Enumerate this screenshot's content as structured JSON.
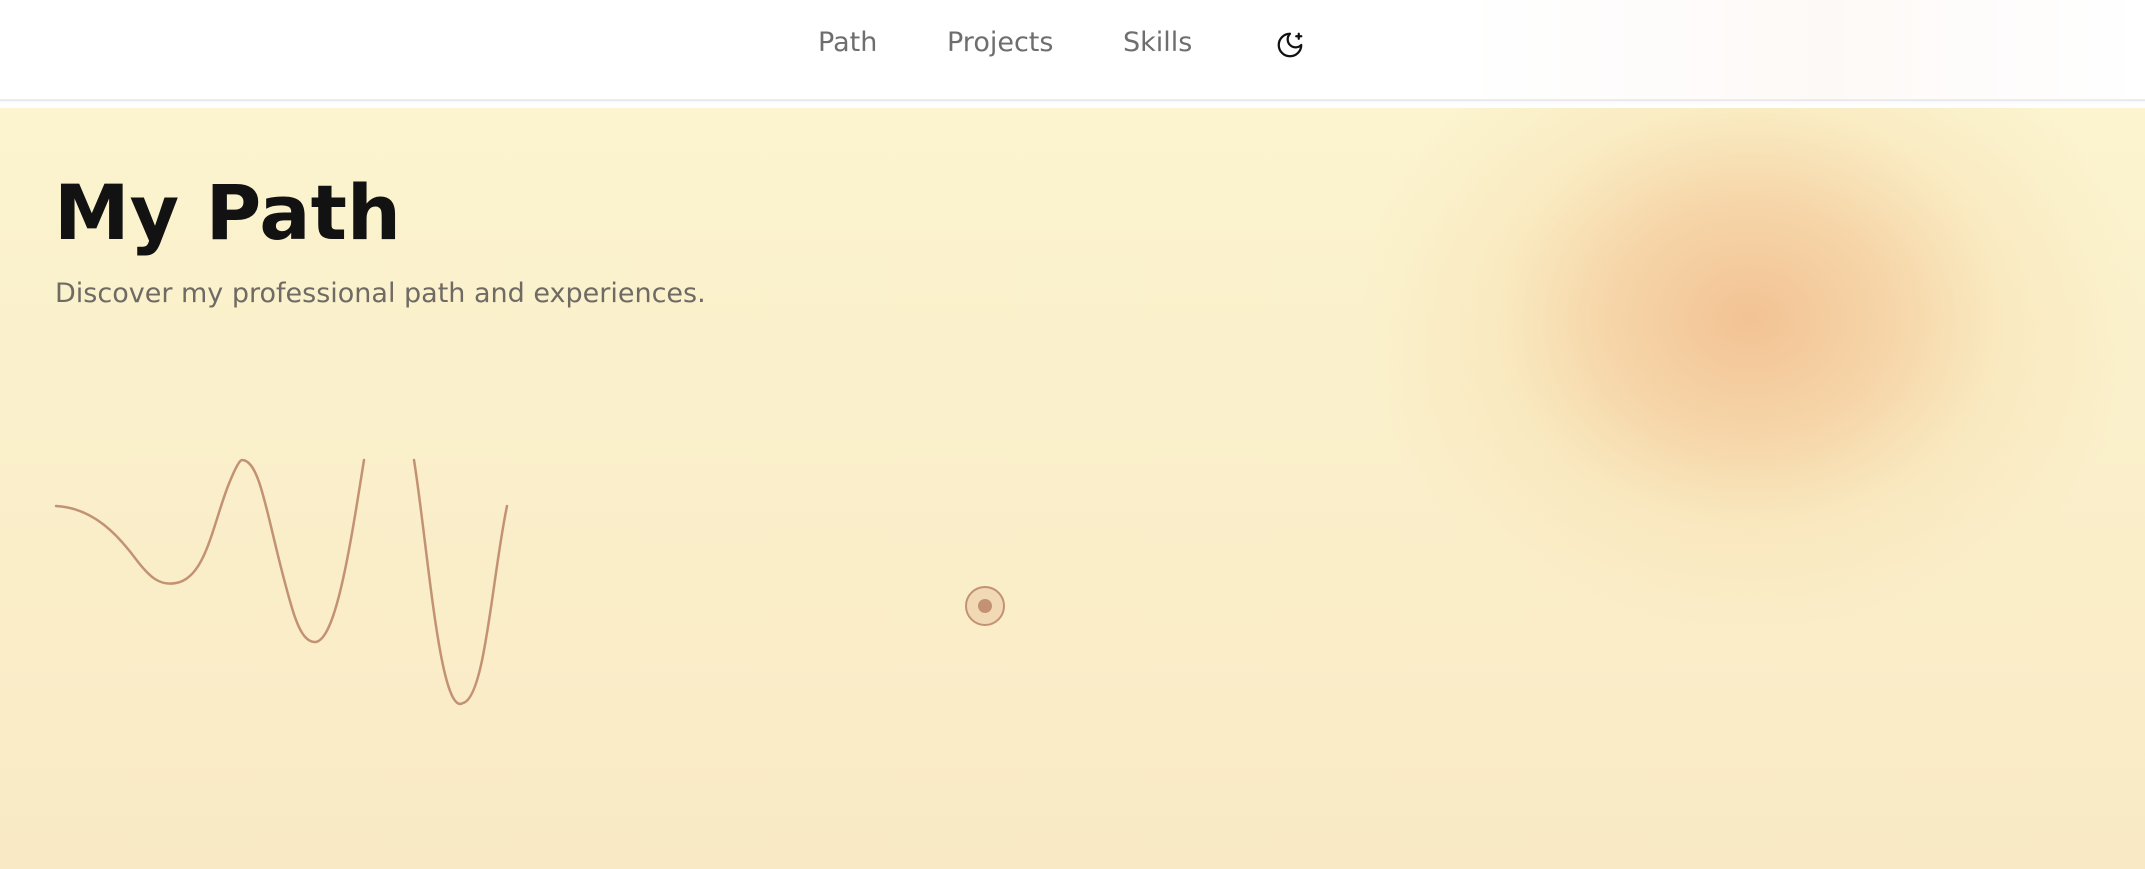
{
  "nav": {
    "items": [
      {
        "label": "Path"
      },
      {
        "label": "Projects"
      },
      {
        "label": "Skills"
      }
    ],
    "theme_toggle_icon": "moon-sparkle-icon"
  },
  "hero": {
    "title": "My Path",
    "subtitle": "Discover my professional path and experiences.",
    "path_marker_icon": "timeline-marker-icon"
  },
  "colors": {
    "background_top": "#fbf4cf",
    "background_bottom": "#f9eac5",
    "accent_blob": "#f2c091",
    "path_stroke": "#c29273",
    "title_text": "#121212",
    "muted_text": "#6f6a63"
  }
}
